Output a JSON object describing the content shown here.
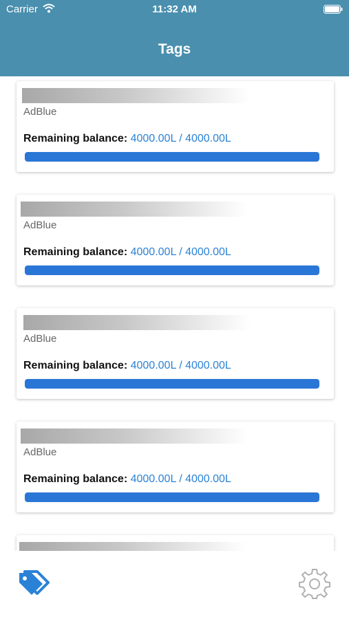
{
  "status_bar": {
    "carrier": "Carrier",
    "time": "11:32 AM"
  },
  "nav": {
    "title": "Tags"
  },
  "tags": [
    {
      "fuel": "AdBlue",
      "balance_label": "Remaining balance:",
      "balance_value": "4000.00L / 4000.00L",
      "fill_fraction": 1.0
    },
    {
      "fuel": "AdBlue",
      "balance_label": "Remaining balance:",
      "balance_value": "4000.00L / 4000.00L",
      "fill_fraction": 1.0
    },
    {
      "fuel": "AdBlue",
      "balance_label": "Remaining balance:",
      "balance_value": "4000.00L / 4000.00L",
      "fill_fraction": 1.0
    },
    {
      "fuel": "AdBlue",
      "balance_label": "Remaining balance:",
      "balance_value": "4000.00L / 4000.00L",
      "fill_fraction": 1.0
    }
  ],
  "tab_bar": {
    "items": [
      {
        "icon": "tags-icon",
        "active": true
      },
      {
        "icon": "gear-icon",
        "active": false
      }
    ]
  },
  "colors": {
    "header": "#4a8fae",
    "accent": "#2a82d6",
    "progress": "#2a76d6",
    "inactive_icon": "#b0b0b0"
  }
}
